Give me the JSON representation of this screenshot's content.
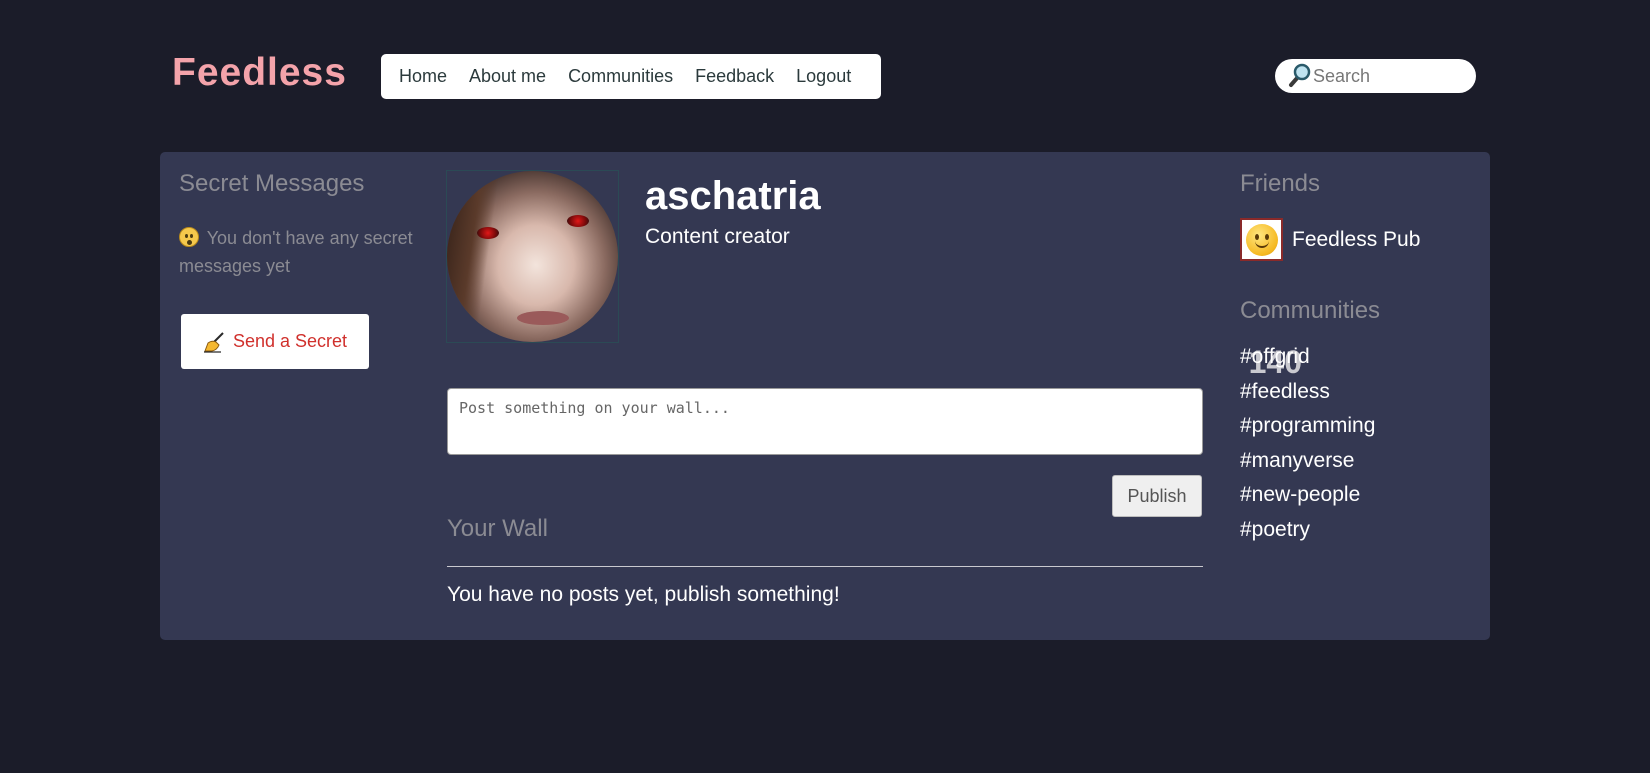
{
  "header": {
    "logo": "Feedless",
    "nav": [
      {
        "label": "Home"
      },
      {
        "label": "About me"
      },
      {
        "label": "Communities"
      },
      {
        "label": "Feedback"
      },
      {
        "label": "Logout"
      }
    ],
    "search": {
      "placeholder": "Search",
      "value": ""
    }
  },
  "secret_messages": {
    "title": "Secret Messages",
    "empty_text": "You don't have any secret messages yet",
    "send_button": "Send a Secret"
  },
  "profile": {
    "username": "aschatria",
    "tagline": "Content creator"
  },
  "composer": {
    "char_count": "140",
    "placeholder": "Post something on your wall...",
    "value": "",
    "publish_label": "Publish"
  },
  "wall": {
    "title": "Your Wall",
    "empty_text": "You have no posts yet, publish something!"
  },
  "friends": {
    "title": "Friends",
    "items": [
      {
        "name": "Feedless Pub"
      }
    ]
  },
  "communities": {
    "title": "Communities",
    "items": [
      {
        "tag": "#offgrid"
      },
      {
        "tag": "#feedless"
      },
      {
        "tag": "#programming"
      },
      {
        "tag": "#manyverse"
      },
      {
        "tag": "#new-people"
      },
      {
        "tag": "#poetry"
      }
    ]
  },
  "colors": {
    "page_background": "#1b1c29",
    "card_background": "#343852",
    "logo": "#f4a3aa",
    "secret_button_text": "#d0302c"
  },
  "icons": {
    "search": "magnifier-icon",
    "secret_empty": "hushed-face-icon",
    "send_secret": "writing-hand-icon",
    "friend_avatar": "smiley-face-icon"
  }
}
